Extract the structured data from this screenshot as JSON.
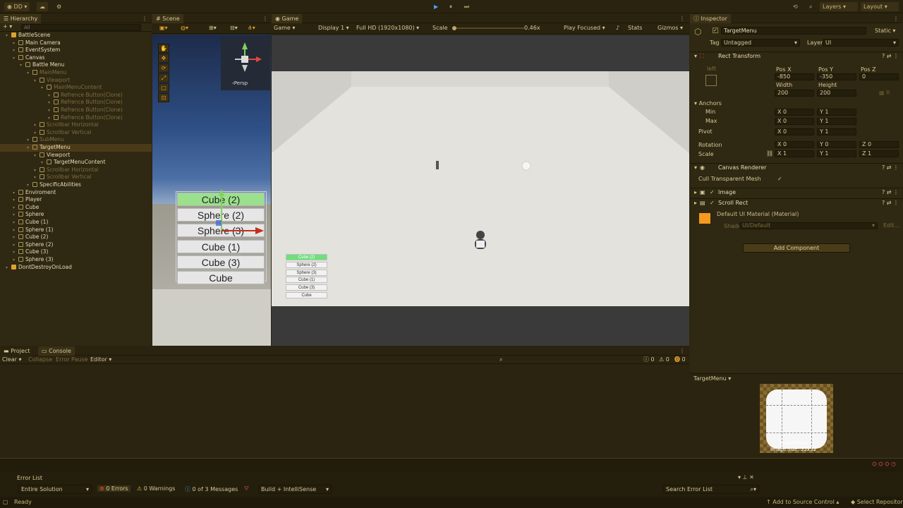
{
  "topbar": {
    "account": "DD",
    "layers": "Layers",
    "layout": "Layout"
  },
  "hierarchy": {
    "tab": "Hierarchy",
    "search_placeholder": "All",
    "items": [
      {
        "label": "BattleScene",
        "indent": 0,
        "style": "white",
        "scene": true
      },
      {
        "label": "Main Camera",
        "indent": 1,
        "style": "white"
      },
      {
        "label": "EventSystem",
        "indent": 1,
        "style": "white"
      },
      {
        "label": "Canvas",
        "indent": 1,
        "style": "white"
      },
      {
        "label": "Battle Menu",
        "indent": 2,
        "style": "white"
      },
      {
        "label": "MainMenu",
        "indent": 3,
        "style": "dim"
      },
      {
        "label": "Viewport",
        "indent": 4,
        "style": "dim"
      },
      {
        "label": "MainMenuContent",
        "indent": 5,
        "style": "dim"
      },
      {
        "label": "Refrence Button(Clone)",
        "indent": 6,
        "style": "dim"
      },
      {
        "label": "Refrence Button(Clone)",
        "indent": 6,
        "style": "dim"
      },
      {
        "label": "Refrence Button(Clone)",
        "indent": 6,
        "style": "dim"
      },
      {
        "label": "Refrence Button(Clone)",
        "indent": 6,
        "style": "dim"
      },
      {
        "label": "Scrollbar Horizontal",
        "indent": 4,
        "style": "dim"
      },
      {
        "label": "Scrollbar Vertical",
        "indent": 4,
        "style": "dim"
      },
      {
        "label": "SubMenu",
        "indent": 3,
        "style": "dim"
      },
      {
        "label": "TargetMenu",
        "indent": 3,
        "style": "white",
        "selected": true
      },
      {
        "label": "Viewport",
        "indent": 4,
        "style": "white"
      },
      {
        "label": "TargetMenuContent",
        "indent": 5,
        "style": "white"
      },
      {
        "label": "Scrollbar Horizontal",
        "indent": 4,
        "style": "dim"
      },
      {
        "label": "Scrollbar Vertical",
        "indent": 4,
        "style": "dim"
      },
      {
        "label": "SpecificAbilities",
        "indent": 3,
        "style": "white"
      },
      {
        "label": "Enviroment",
        "indent": 1,
        "style": "white"
      },
      {
        "label": "Player",
        "indent": 1,
        "style": "white"
      },
      {
        "label": "Cube",
        "indent": 1,
        "style": "white"
      },
      {
        "label": "Sphere",
        "indent": 1,
        "style": "white"
      },
      {
        "label": "Cube (1)",
        "indent": 1,
        "style": "white"
      },
      {
        "label": "Sphere (1)",
        "indent": 1,
        "style": "white"
      },
      {
        "label": "Cube (2)",
        "indent": 1,
        "style": "white"
      },
      {
        "label": "Sphere (2)",
        "indent": 1,
        "style": "white"
      },
      {
        "label": "Cube (3)",
        "indent": 1,
        "style": "white"
      },
      {
        "label": "Sphere (3)",
        "indent": 1,
        "style": "white"
      },
      {
        "label": "DontDestroyOnLoad",
        "indent": 0,
        "style": "white",
        "scene": true
      }
    ]
  },
  "scene": {
    "tab": "Scene",
    "persp": "‹Persp",
    "menu_items": [
      "Cube (2)",
      "Sphere (2)",
      "Sphere (3)",
      "Cube (1)",
      "Cube (3)",
      "Cube"
    ]
  },
  "game": {
    "tab": "Game",
    "view": "Game",
    "display": "Display 1",
    "resolution": "Full HD (1920x1080)",
    "scale_label": "Scale",
    "scale_value": "0.46x",
    "play_mode": "Play Focused",
    "stats": "Stats",
    "gizmos": "Gizmos",
    "mini_items": [
      "Cube (2)",
      "Sphere (2)",
      "Sphere (3)",
      "Cube (1)",
      "Cube (3)",
      "Cube"
    ]
  },
  "inspector": {
    "tab": "Inspector",
    "object_name": "TargetMenu",
    "static": "Static",
    "tag_label": "Tag",
    "tag_value": "Untagged",
    "layer_label": "Layer",
    "layer_value": "UI",
    "rect_transform": "Rect Transform",
    "left": "left",
    "posx_label": "Pos X",
    "posy_label": "Pos Y",
    "posz_label": "Pos Z",
    "posx": "-850",
    "posy": "-350",
    "posz": "0",
    "width_label": "Width",
    "height_label": "Height",
    "width": "200",
    "height": "200",
    "anchors": "Anchors",
    "min": "Min",
    "max": "Max",
    "pivot": "Pivot",
    "rotation": "Rotation",
    "scale": "Scale",
    "min_x": "X 0",
    "min_y": "Y 1",
    "max_x": "X 0",
    "max_y": "Y 1",
    "pivot_x": "X 0",
    "pivot_y": "Y 1",
    "rot_x": "X 0",
    "rot_y": "Y 0",
    "rot_z": "Z 0",
    "scale_x": "X 1",
    "scale_y": "Y 1",
    "scale_z": "Z 1",
    "canvas_renderer": "Canvas Renderer",
    "cull": "Cull Transparent Mesh",
    "image": "Image",
    "scroll_rect": "Scroll Rect",
    "material": "Default UI Material (Material)",
    "shader_label": "Shader",
    "shader_value": "UI/Default",
    "edit": "Edit...",
    "add_component": "Add Component",
    "preview_title": "TargetMenu",
    "preview_name": "TargetMenu",
    "preview_size": "Image Size: 32x32"
  },
  "console": {
    "project_tab": "Project",
    "console_tab": "Console",
    "clear": "Clear",
    "collapse": "Collapse",
    "error_pause": "Error Pause",
    "editor": "Editor",
    "count_warn": "0",
    "count_err": "0",
    "count_info": "0"
  },
  "errorlist": {
    "title": "Error List",
    "scope": "Entire Solution",
    "errors": "0 Errors",
    "warnings": "0 Warnings",
    "messages": "0 of 3 Messages",
    "build": "Build + IntelliSense",
    "search": "Search Error List"
  },
  "status": {
    "ready": "Ready",
    "source_control": "Add to Source Control",
    "repo": "Select Repository"
  },
  "colors": {
    "accent": "#e0a030",
    "selected": "#4a3a18",
    "orange": "#f59a1e"
  }
}
